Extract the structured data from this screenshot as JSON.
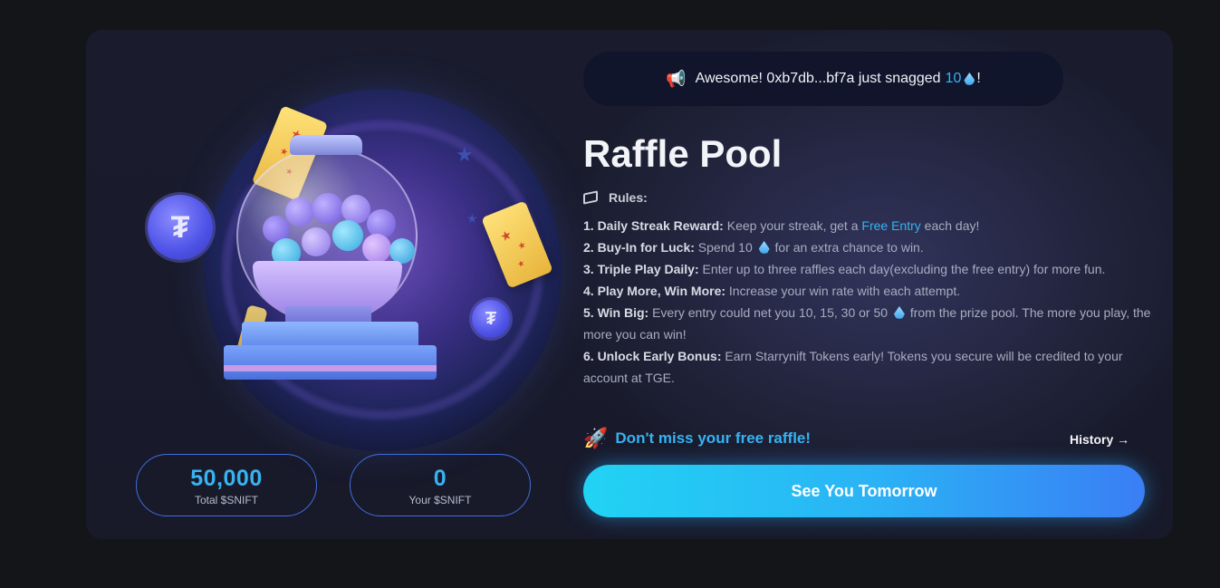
{
  "ticker": {
    "prefix": "Awesome! 0xb7db...bf7a just snagged",
    "amount": "10",
    "suffix": "!",
    "icon": "megaphone-icon",
    "token_icon": "drop-icon"
  },
  "title": "Raffle Pool",
  "rules": {
    "heading": "Rules:",
    "icon": "book-icon",
    "items": [
      {
        "label": "1. Daily Streak Reward:",
        "text_before": "Keep your streak, get a",
        "link": "Free Entry",
        "text_after": "each day!"
      },
      {
        "label": "2. Buy-In for Luck:",
        "text_before": "Spend 10",
        "text_after": "for an extra chance to win."
      },
      {
        "label": "3. Triple Play Daily:",
        "text": "Enter up to three raffles each day(excluding the free entry) for more fun."
      },
      {
        "label": "4. Play More, Win More:",
        "text": "Increase your win rate with each attempt."
      },
      {
        "label": "5. Win Big:",
        "text_before": "Every entry could net you 10, 15, 30 or 50",
        "text_after": "from the prize pool. The more you play, the more you can win!"
      },
      {
        "label": "6. Unlock Early Bonus:",
        "text": "Earn Starrynift Tokens early! Tokens you secure will be credited to your account at TGE."
      }
    ]
  },
  "promo": {
    "text": "Don't miss your free raffle!",
    "icon": "rocket-icon"
  },
  "history": {
    "label": "History →"
  },
  "cta": {
    "label": "See You Tomorrow"
  },
  "stats": {
    "total": {
      "value": "50,000",
      "label": "Total $SNIFT"
    },
    "yours": {
      "value": "0",
      "label": "Your $SNIFT"
    }
  },
  "colors": {
    "accent": "#35b3f2",
    "background": "#141518",
    "card": "#1a1c2e",
    "button_start": "#21d3f4",
    "button_end": "#3a7ef5"
  }
}
